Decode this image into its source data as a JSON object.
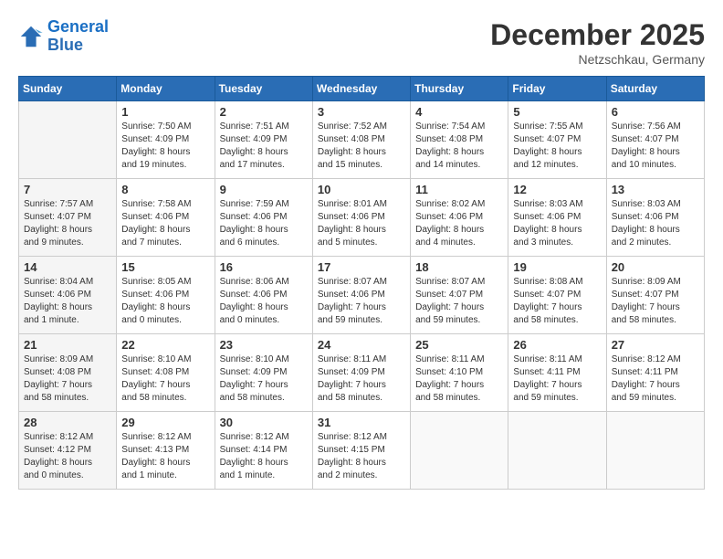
{
  "header": {
    "logo_line1": "General",
    "logo_line2": "Blue",
    "month": "December 2025",
    "location": "Netzschkau, Germany"
  },
  "weekdays": [
    "Sunday",
    "Monday",
    "Tuesday",
    "Wednesday",
    "Thursday",
    "Friday",
    "Saturday"
  ],
  "weeks": [
    [
      {
        "day": "",
        "info": ""
      },
      {
        "day": "1",
        "info": "Sunrise: 7:50 AM\nSunset: 4:09 PM\nDaylight: 8 hours\nand 19 minutes."
      },
      {
        "day": "2",
        "info": "Sunrise: 7:51 AM\nSunset: 4:09 PM\nDaylight: 8 hours\nand 17 minutes."
      },
      {
        "day": "3",
        "info": "Sunrise: 7:52 AM\nSunset: 4:08 PM\nDaylight: 8 hours\nand 15 minutes."
      },
      {
        "day": "4",
        "info": "Sunrise: 7:54 AM\nSunset: 4:08 PM\nDaylight: 8 hours\nand 14 minutes."
      },
      {
        "day": "5",
        "info": "Sunrise: 7:55 AM\nSunset: 4:07 PM\nDaylight: 8 hours\nand 12 minutes."
      },
      {
        "day": "6",
        "info": "Sunrise: 7:56 AM\nSunset: 4:07 PM\nDaylight: 8 hours\nand 10 minutes."
      }
    ],
    [
      {
        "day": "7",
        "info": "Sunrise: 7:57 AM\nSunset: 4:07 PM\nDaylight: 8 hours\nand 9 minutes."
      },
      {
        "day": "8",
        "info": "Sunrise: 7:58 AM\nSunset: 4:06 PM\nDaylight: 8 hours\nand 7 minutes."
      },
      {
        "day": "9",
        "info": "Sunrise: 7:59 AM\nSunset: 4:06 PM\nDaylight: 8 hours\nand 6 minutes."
      },
      {
        "day": "10",
        "info": "Sunrise: 8:01 AM\nSunset: 4:06 PM\nDaylight: 8 hours\nand 5 minutes."
      },
      {
        "day": "11",
        "info": "Sunrise: 8:02 AM\nSunset: 4:06 PM\nDaylight: 8 hours\nand 4 minutes."
      },
      {
        "day": "12",
        "info": "Sunrise: 8:03 AM\nSunset: 4:06 PM\nDaylight: 8 hours\nand 3 minutes."
      },
      {
        "day": "13",
        "info": "Sunrise: 8:03 AM\nSunset: 4:06 PM\nDaylight: 8 hours\nand 2 minutes."
      }
    ],
    [
      {
        "day": "14",
        "info": "Sunrise: 8:04 AM\nSunset: 4:06 PM\nDaylight: 8 hours\nand 1 minute."
      },
      {
        "day": "15",
        "info": "Sunrise: 8:05 AM\nSunset: 4:06 PM\nDaylight: 8 hours\nand 0 minutes."
      },
      {
        "day": "16",
        "info": "Sunrise: 8:06 AM\nSunset: 4:06 PM\nDaylight: 8 hours\nand 0 minutes."
      },
      {
        "day": "17",
        "info": "Sunrise: 8:07 AM\nSunset: 4:06 PM\nDaylight: 7 hours\nand 59 minutes."
      },
      {
        "day": "18",
        "info": "Sunrise: 8:07 AM\nSunset: 4:07 PM\nDaylight: 7 hours\nand 59 minutes."
      },
      {
        "day": "19",
        "info": "Sunrise: 8:08 AM\nSunset: 4:07 PM\nDaylight: 7 hours\nand 58 minutes."
      },
      {
        "day": "20",
        "info": "Sunrise: 8:09 AM\nSunset: 4:07 PM\nDaylight: 7 hours\nand 58 minutes."
      }
    ],
    [
      {
        "day": "21",
        "info": "Sunrise: 8:09 AM\nSunset: 4:08 PM\nDaylight: 7 hours\nand 58 minutes."
      },
      {
        "day": "22",
        "info": "Sunrise: 8:10 AM\nSunset: 4:08 PM\nDaylight: 7 hours\nand 58 minutes."
      },
      {
        "day": "23",
        "info": "Sunrise: 8:10 AM\nSunset: 4:09 PM\nDaylight: 7 hours\nand 58 minutes."
      },
      {
        "day": "24",
        "info": "Sunrise: 8:11 AM\nSunset: 4:09 PM\nDaylight: 7 hours\nand 58 minutes."
      },
      {
        "day": "25",
        "info": "Sunrise: 8:11 AM\nSunset: 4:10 PM\nDaylight: 7 hours\nand 58 minutes."
      },
      {
        "day": "26",
        "info": "Sunrise: 8:11 AM\nSunset: 4:11 PM\nDaylight: 7 hours\nand 59 minutes."
      },
      {
        "day": "27",
        "info": "Sunrise: 8:12 AM\nSunset: 4:11 PM\nDaylight: 7 hours\nand 59 minutes."
      }
    ],
    [
      {
        "day": "28",
        "info": "Sunrise: 8:12 AM\nSunset: 4:12 PM\nDaylight: 8 hours\nand 0 minutes."
      },
      {
        "day": "29",
        "info": "Sunrise: 8:12 AM\nSunset: 4:13 PM\nDaylight: 8 hours\nand 1 minute."
      },
      {
        "day": "30",
        "info": "Sunrise: 8:12 AM\nSunset: 4:14 PM\nDaylight: 8 hours\nand 1 minute."
      },
      {
        "day": "31",
        "info": "Sunrise: 8:12 AM\nSunset: 4:15 PM\nDaylight: 8 hours\nand 2 minutes."
      },
      {
        "day": "",
        "info": ""
      },
      {
        "day": "",
        "info": ""
      },
      {
        "day": "",
        "info": ""
      }
    ]
  ]
}
